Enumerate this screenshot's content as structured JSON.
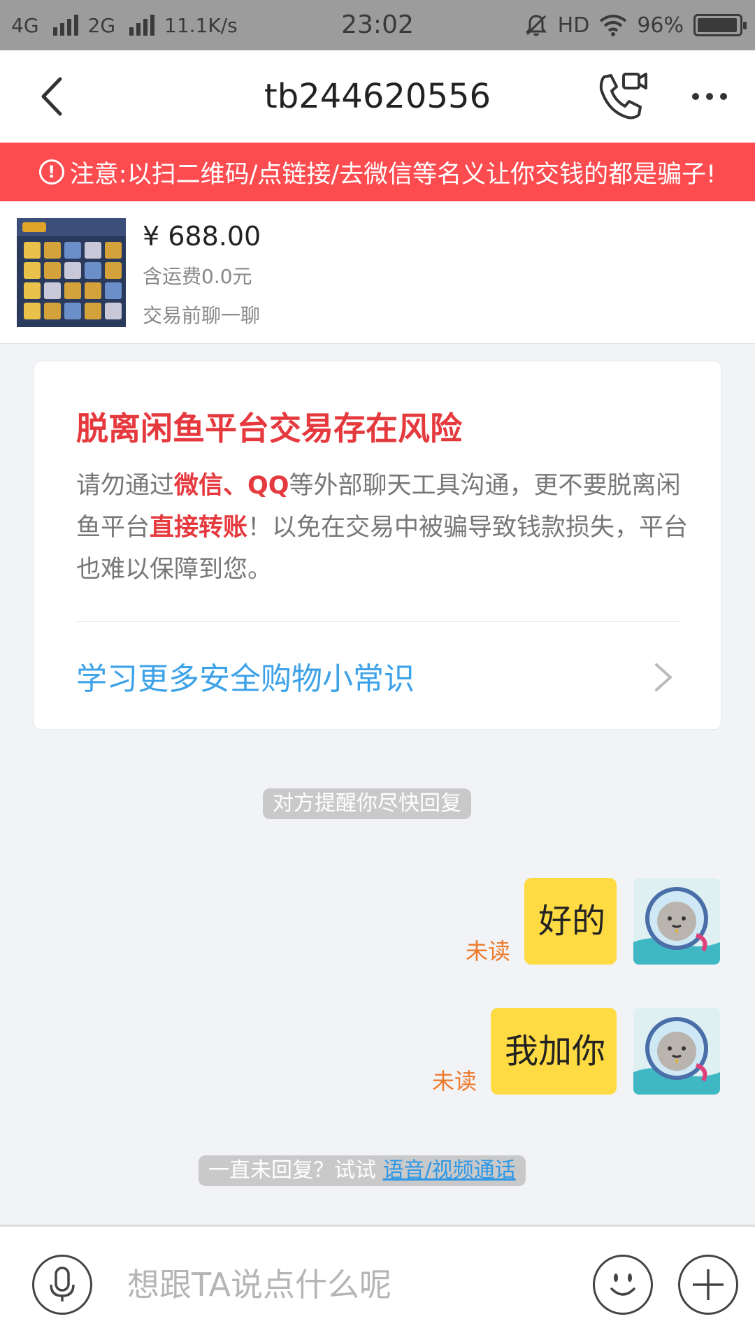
{
  "status_bar": {
    "network1": "4G",
    "network2": "2G",
    "speed": "11.1K/s",
    "time": "23:02",
    "hd": "HD",
    "battery": "96%",
    "battery_level": 0.96
  },
  "header": {
    "title": "tb244620556"
  },
  "warning_banner": {
    "text": "注意:以扫二维码/点链接/去微信等名义让你交钱的都是骗子!"
  },
  "product": {
    "price": "¥ 688.00",
    "shipping": "含运费0.0元",
    "note": "交易前聊一聊"
  },
  "risk_card": {
    "title": "脱离闲鱼平台交易存在风险",
    "body_1": "请勿通过",
    "body_hl_1": "微信、QQ",
    "body_2": "等外部聊天工具沟通，更不要脱离闲鱼平台",
    "body_hl_2": "直接转账",
    "body_3": "！以免在交易中被骗导致钱款损失，平台也难以保障到您。",
    "link": "学习更多安全购物小常识"
  },
  "reminder_chip": "对方提醒你尽快回复",
  "messages": [
    {
      "text": "好的",
      "status": "未读"
    },
    {
      "text": "我加你",
      "status": "未读"
    }
  ],
  "call_tip": {
    "prefix": "一直未回复？试试 ",
    "link": "语音/视频通话"
  },
  "input": {
    "placeholder": "想跟TA说点什么呢"
  },
  "colors": {
    "warning": "#fd4c50",
    "bubble": "#fedb43",
    "risk_red": "#e5393e",
    "link_blue": "#3da2e8",
    "unread_orange": "#ee7a2b"
  }
}
